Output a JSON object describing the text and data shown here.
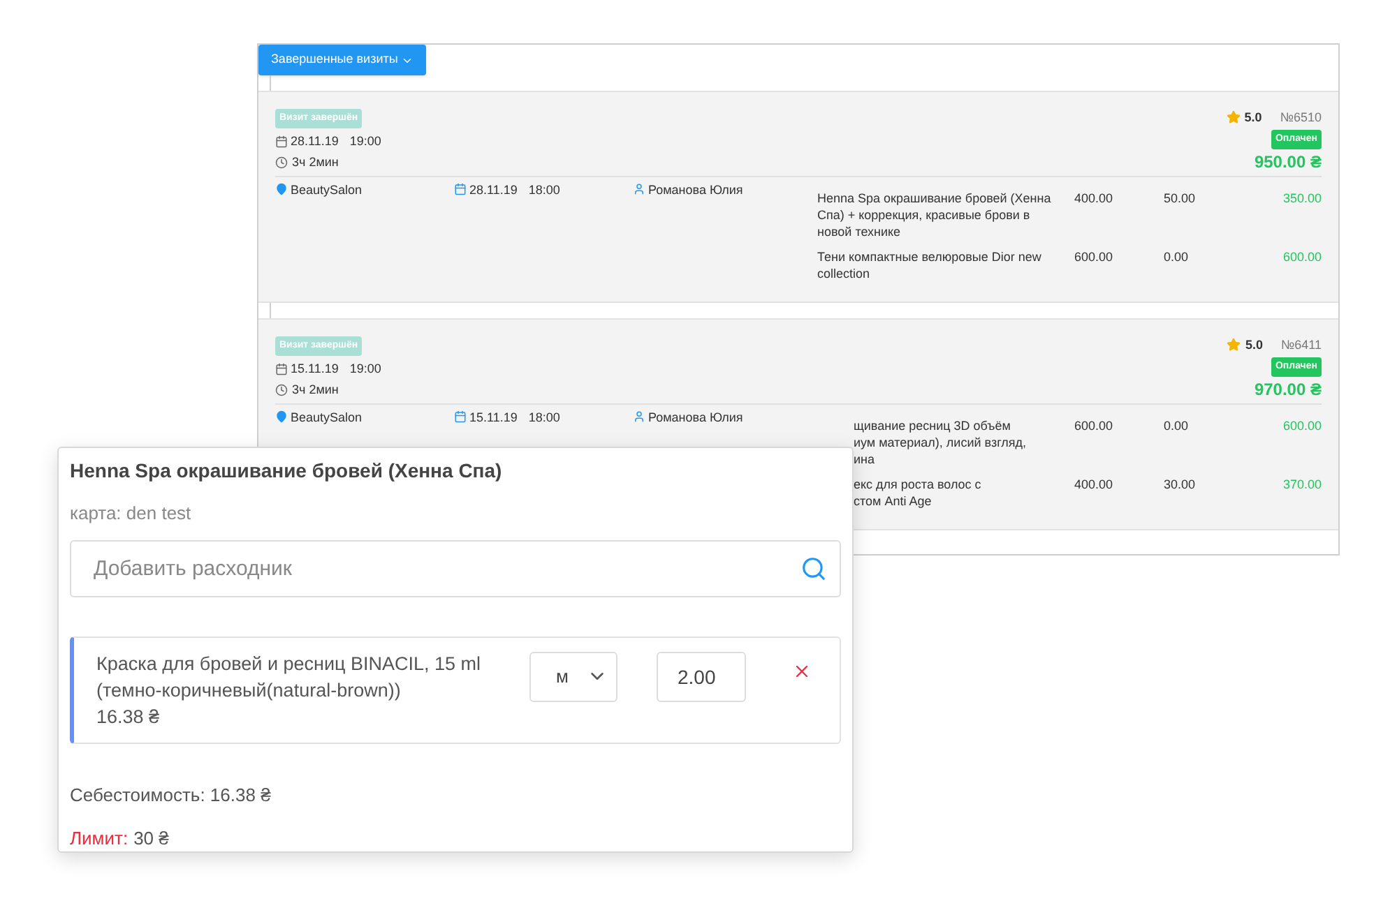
{
  "visits_panel": {
    "filter_button": "Завершенные визиты",
    "visits": [
      {
        "status": "Визит завершён",
        "date": "28.11.19",
        "time": "19:00",
        "duration": "3ч 2мин",
        "rating": "5.0",
        "number": "№6510",
        "payment": "Оплачен",
        "total": "950.00 ₴",
        "covered": false,
        "location": "BeautySalon",
        "booked_date": "28.11.19",
        "booked_time": "18:00",
        "master": "Романова Юлия",
        "services": [
          {
            "name_lines": [
              "Henna Spa окрашивание бровей (Хенна",
              "Спа) + коррекция, красивые брови в",
              "новой технике"
            ],
            "price": "400.00",
            "discount": "50.00",
            "sum": "350.00"
          },
          {
            "name_lines": [
              "Тени компактные велюровые Dior new",
              "collection"
            ],
            "price": "600.00",
            "discount": "0.00",
            "sum": "600.00"
          }
        ]
      },
      {
        "status": "Визит завершён",
        "date": "15.11.19",
        "time": "19:00",
        "duration": "3ч 2мин",
        "rating": "5.0",
        "number": "№6411",
        "payment": "Оплачен",
        "total": "970.00 ₴",
        "covered": true,
        "location": "BeautySalon",
        "booked_date": "15.11.19",
        "booked_time": "18:00",
        "master": "Романова Юлия",
        "services": [
          {
            "name_lines": [
              "щивание ресниц 3D объём",
              "иум материал), лисий взгляд,",
              "ина"
            ],
            "price": "600.00",
            "discount": "0.00",
            "sum": "600.00"
          },
          {
            "name_lines": [
              "екс для роста волос с",
              "стом Anti Age"
            ],
            "price": "400.00",
            "discount": "30.00",
            "sum": "370.00"
          }
        ]
      }
    ]
  },
  "consumables_card": {
    "title": "Henna Spa окрашивание бровей (Хенна Спа)",
    "card": "карта: den test",
    "search_placeholder": "Добавить расходник",
    "items": [
      {
        "name_lines": [
          "Краска для бровей и ресниц BINACIL, 15 ml",
          "(темно-коричневый(natural-brown))"
        ],
        "price": "16.38 ₴",
        "unit": "м",
        "quantity": "2.00"
      }
    ],
    "cost": "Себестоимость: 16.38 ₴",
    "limit_label": "Лимит:",
    "limit_value": "30 ₴"
  }
}
